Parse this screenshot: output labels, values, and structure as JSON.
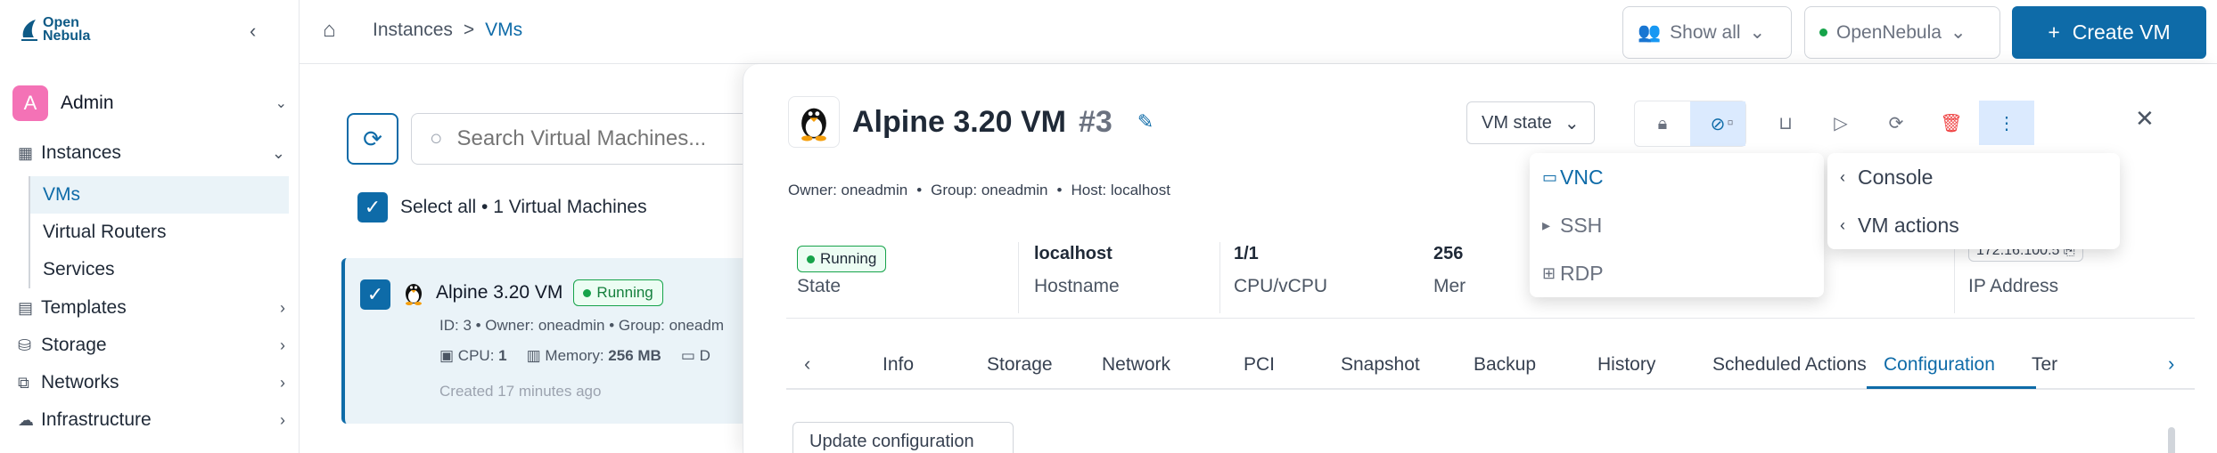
{
  "sidebar": {
    "logo_line1": "Open",
    "logo_line2": "Nebula",
    "user": {
      "initial": "A",
      "name": "Admin"
    },
    "items": [
      {
        "label": "Instances"
      },
      {
        "label": "Templates"
      },
      {
        "label": "Storage"
      },
      {
        "label": "Networks"
      },
      {
        "label": "Infrastructure"
      }
    ],
    "sub_items": [
      {
        "label": "VMs"
      },
      {
        "label": "Virtual Routers"
      },
      {
        "label": "Services"
      }
    ]
  },
  "topbar": {
    "breadcrumb": [
      "Instances",
      ">",
      "VMs"
    ],
    "show_all": "Show all",
    "zone": "OpenNebula",
    "create_label": "Create VM"
  },
  "list": {
    "search_placeholder": "Search Virtual Machines...",
    "select_all": "Select all • 1 Virtual Machines",
    "vm": {
      "name": "Alpine 3.20 VM",
      "status": "Running",
      "meta": "ID: 3 • Owner: oneadmin • Group: oneadm",
      "cpu_label": "CPU:",
      "cpu_value": "1",
      "memory_label": "Memory:",
      "memory_value": "256 MB",
      "disk_label": "D",
      "created": "Created 17 minutes ago"
    }
  },
  "panel": {
    "name": "Alpine 3.20 VM",
    "id": "#3",
    "owner": "Owner: oneadmin",
    "group": "Group: oneadmin",
    "host": "Host: localhost",
    "sep": "•",
    "vm_state_label": "VM state",
    "stats": [
      {
        "value": "Running",
        "label": "State"
      },
      {
        "value": "localhost",
        "label": "Hostname"
      },
      {
        "value": "1/1",
        "label": "CPU/vCPU"
      },
      {
        "value": "256",
        "label": "Mer"
      },
      {
        "value": "172.16.100.5",
        "label": "IP Address"
      }
    ],
    "tabs": [
      "Info",
      "Storage",
      "Network",
      "PCI",
      "Snapshot",
      "Backup",
      "History",
      "Scheduled Actions",
      "Configuration",
      "Ter"
    ],
    "active_tab": "Configuration",
    "update_button": "Update configuration"
  },
  "console_menu": [
    {
      "label": "VNC",
      "icon": "monitor-icon"
    },
    {
      "label": "SSH",
      "icon": "terminal-icon"
    },
    {
      "label": "RDP",
      "icon": "window-icon"
    }
  ],
  "actions_menu": [
    {
      "label": "Console"
    },
    {
      "label": "VM actions"
    }
  ],
  "colors": {
    "accent": "#0e6ba8",
    "running": "#16a34a",
    "danger": "#ef4444"
  }
}
